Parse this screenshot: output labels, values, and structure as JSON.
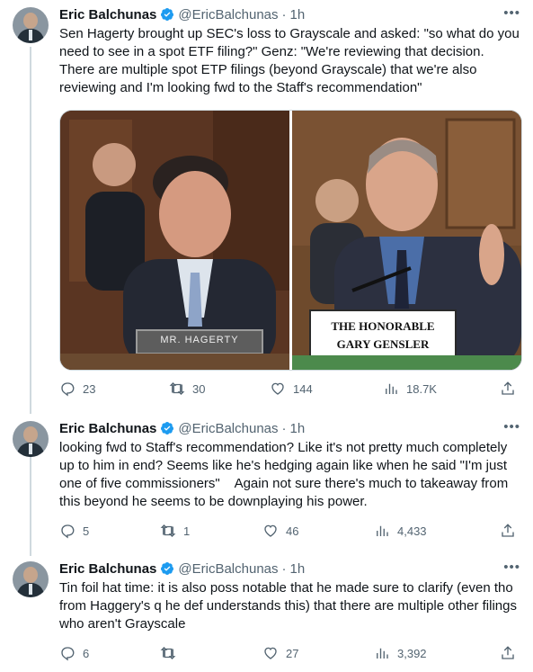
{
  "tweets": [
    {
      "name": "Eric Balchunas",
      "handle": "@EricBalchunas",
      "time": "1h",
      "text": "Sen Hagerty brought up SEC's loss to Grayscale and asked: \"so what do you need to see in a spot ETF filing?\" Genz: \"We're reviewing that decision. There are multiple spot ETP filings (beyond Grayscale) that we're also reviewing and I'm looking fwd to the Staff's recommendation\"",
      "media": {
        "left_nameplate": "MR. HAGERTY",
        "right_nameplate_line1": "THE HONORABLE",
        "right_nameplate_line2": "GARY GENSLER"
      },
      "replies": "23",
      "retweets": "30",
      "likes": "144",
      "views": "18.7K"
    },
    {
      "name": "Eric Balchunas",
      "handle": "@EricBalchunas",
      "time": "1h",
      "text": "looking fwd to Staff's recommendation? Like it's not pretty much completely up to him in end? Seems like he's hedging again like when he said \"I'm just one of five commissioners\"    Again not sure there's much to takeaway from this beyond he seems to be downplaying his power.",
      "replies": "5",
      "retweets": "1",
      "likes": "46",
      "views": "4,433"
    },
    {
      "name": "Eric Balchunas",
      "handle": "@EricBalchunas",
      "time": "1h",
      "text": "Tin foil hat time: it is also poss notable that he made sure to clarify (even tho from Haggery's q he def understands this) that there are multiple other filings who aren't Grayscale",
      "replies": "6",
      "retweets": "",
      "likes": "27",
      "views": "3,392"
    }
  ],
  "colors": {
    "verified": "#1d9bf0",
    "muted": "#536471",
    "text": "#0f1419",
    "divider": "#cfd9de"
  },
  "icons": {
    "verified": "verified-badge-icon",
    "more": "more-icon",
    "reply": "reply-icon",
    "retweet": "retweet-icon",
    "like": "like-icon",
    "views": "views-icon",
    "share": "share-icon"
  }
}
